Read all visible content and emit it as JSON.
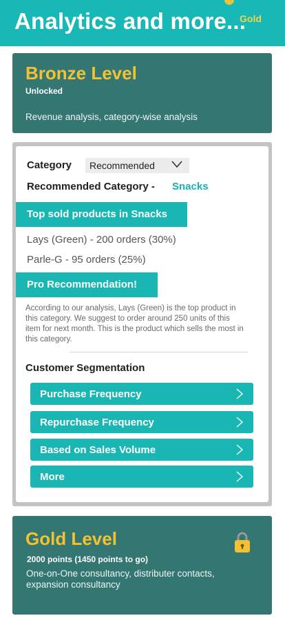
{
  "header": {
    "title": "Analytics and more...",
    "badge": "Gold",
    "medal_icon": "medal-icon",
    "bg": "#17b8b6"
  },
  "bronze": {
    "title": "Bronze Level",
    "status": "Unlocked",
    "description": "Revenue analysis, category-wise analysis"
  },
  "panel": {
    "category_label": "Category",
    "category_selected": "Recommended",
    "recommended_label": "Recommended Category -",
    "recommended_value": "Snacks",
    "top_sold_title": "Top sold products in Snacks",
    "products": [
      "Lays (Green) - 200 orders (30%)",
      "Parle-G - 95 orders (25%)"
    ],
    "pro_title": "Pro Recommendation!",
    "pro_text": "According to our analysis, Lays (Green) is the top product in this category. We suggest to order around 250 units of this item for next month. This is the product which sells the most in this category.",
    "segmentation_title": "Customer Segmentation",
    "segments": [
      "Purchase Frequency",
      "Repurchase Frequency",
      "Based on Sales Volume",
      "More"
    ]
  },
  "gold": {
    "title": "Gold Level",
    "points": "2000 points (1450 points to go)",
    "description": "One-on-One consultancy, distributer contacts, expansion consultancy",
    "lock_icon": "lock-icon"
  },
  "colors": {
    "accent": "#1ab6b4",
    "card": "#337672",
    "level_title": "#f2c233"
  }
}
